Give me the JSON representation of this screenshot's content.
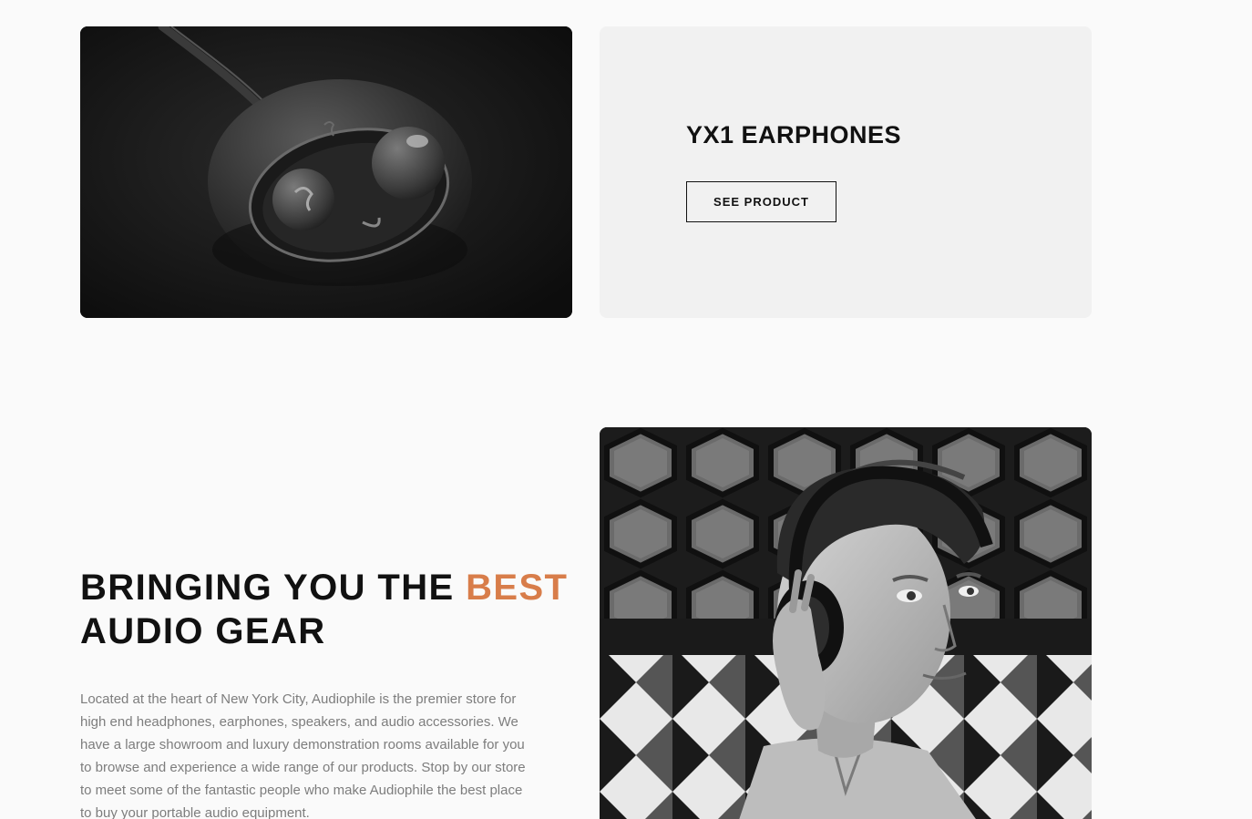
{
  "earphones": {
    "image_alt": "YX1 earphones in charging case",
    "title": "YX1 EARPHONES",
    "button_label": "SEE PRODUCT"
  },
  "best_gear": {
    "heading_before": "BRINGING YOU THE ",
    "heading_accent": "BEST",
    "heading_after": "AUDIO GEAR",
    "body": "Located at the heart of New York City, Audiophile is the premier store for high end headphones, earphones, speakers, and audio accessories. We have a large showroom and luxury demonstration rooms available for you to browse and experience a wide range of our products. Stop by our store to meet some of the fantastic people who make Audiophile the best place to buy your portable audio equipment.",
    "image_alt": "Man wearing headphones"
  },
  "colors": {
    "accent": "#d87d4a",
    "page_bg": "#fafafa",
    "card_bg": "#f1f1f1",
    "text_dark": "#111111",
    "text_body": "#7d7d7d"
  }
}
